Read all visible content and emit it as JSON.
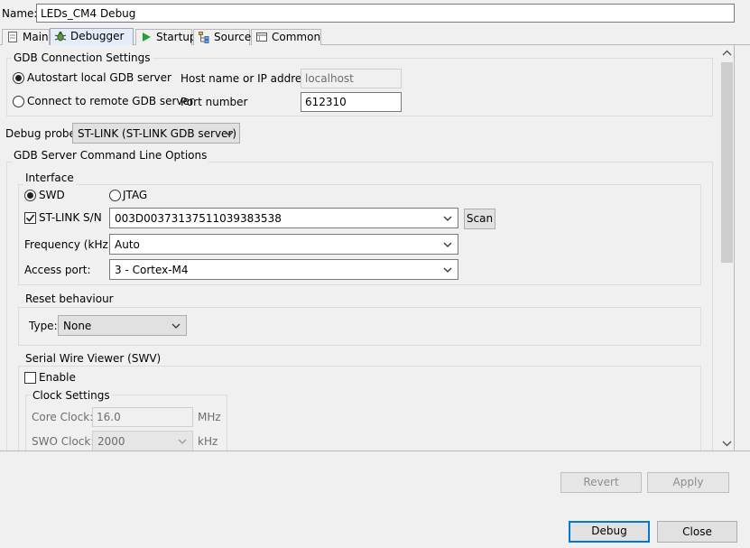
{
  "name": {
    "label": "Name:",
    "value": "LEDs_CM4 Debug"
  },
  "tabs": [
    {
      "label": "Main",
      "icon": "main-tab-icon"
    },
    {
      "label": "Debugger",
      "icon": "debugger-bug-icon"
    },
    {
      "label": "Startup",
      "icon": "startup-play-icon"
    },
    {
      "label": "Source",
      "icon": "source-lookup-icon"
    },
    {
      "label": "Common",
      "icon": "common-tab-icon"
    }
  ],
  "gdb_connection": {
    "title": "GDB Connection Settings",
    "autostart_label": "Autostart local GDB server",
    "autostart_selected": true,
    "remote_label": "Connect to remote GDB server",
    "remote_selected": false,
    "host_label": "Host name or IP address",
    "host_value": "localhost",
    "port_label": "Port number",
    "port_value": "612310"
  },
  "debug_probe": {
    "label": "Debug probe",
    "value": "ST-LINK (ST-LINK GDB server)"
  },
  "gdb_server": {
    "title": "GDB Server Command Line Options",
    "interface": {
      "title": "Interface",
      "swd_label": "SWD",
      "swd_selected": true,
      "jtag_label": "JTAG",
      "jtag_selected": false,
      "stlink_sn_label": "ST-LINK S/N",
      "stlink_sn_checked": true,
      "stlink_sn_value": "003D00373137511039383538",
      "scan_label": "Scan",
      "frequency_label": "Frequency (kHz):",
      "frequency_value": "Auto",
      "access_port_label": "Access port:",
      "access_port_value": "3 - Cortex-M4"
    },
    "reset": {
      "title": "Reset behaviour",
      "type_label": "Type:",
      "type_value": "None"
    },
    "swv": {
      "title": "Serial Wire Viewer (SWV)",
      "enable_label": "Enable",
      "enable_checked": false,
      "clock_settings_title": "Clock Settings",
      "core_clock_label": "Core Clock:",
      "core_clock_value": "16.0",
      "core_clock_unit": "MHz",
      "swo_clock_label": "SWO Clock:",
      "swo_clock_value": "2000",
      "swo_clock_unit": "kHz"
    }
  },
  "buttons": {
    "revert": "Revert",
    "apply": "Apply",
    "debug": "Debug",
    "close": "Close"
  },
  "colors": {
    "accent": "#0078d7",
    "selected_tab": "#e4eefb"
  }
}
